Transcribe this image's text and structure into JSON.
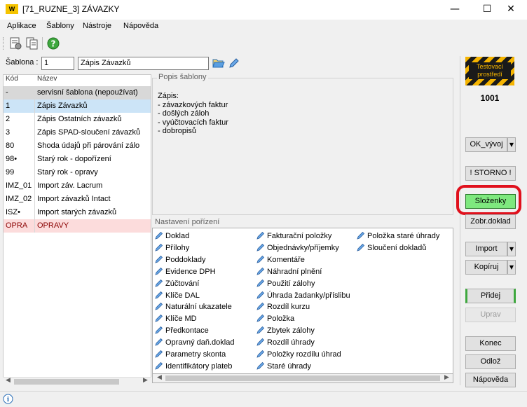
{
  "window": {
    "title": "[71_RUZNE_3] ZÁVAZKY",
    "logo_text": "W",
    "minimize": "—",
    "maximize": "☐",
    "close": "✕"
  },
  "menu": [
    "Aplikace",
    "Šablony",
    "Nástroje",
    "Nápověda"
  ],
  "template": {
    "label": "Šablona :",
    "code": "1",
    "name": "Zápis Závazků"
  },
  "grid": {
    "headers": {
      "code": "Kód",
      "name": "Název"
    },
    "rows": [
      {
        "code": "-",
        "name": "servisní šablona (nepoužívat)"
      },
      {
        "code": "1",
        "name": "Zápis Závazků"
      },
      {
        "code": "2",
        "name": "Zápis Ostatních závazků"
      },
      {
        "code": "3",
        "name": "Zápis SPAD-sloučení závazků"
      },
      {
        "code": "80",
        "name": "Shoda údajů při párování zálo"
      },
      {
        "code": "98•",
        "name": "Starý rok - dopořízení"
      },
      {
        "code": "99",
        "name": "Starý rok - opravy"
      },
      {
        "code": "IMZ_01",
        "name": "Import záv. Lacrum"
      },
      {
        "code": "IMZ_02",
        "name": "Import závazků Intact"
      },
      {
        "code": "ISZ•",
        "name": "Import starých závazků"
      },
      {
        "code": "OPRA",
        "name": "OPRAVY"
      }
    ]
  },
  "description": {
    "title": "Popis šablony",
    "lines": [
      "Zápis:",
      "- závazkových faktur",
      "- došlých záloh",
      "- vyúčtovacích faktur",
      "- dobropisů"
    ]
  },
  "settings": {
    "title": "Nastavení pořízení",
    "col1": [
      "Doklad",
      "Přílohy",
      "Poddoklady",
      "Evidence DPH",
      "Zúčtování",
      "Klíče DAL",
      "Naturální ukazatele",
      "Klíče MD",
      "Předkontace",
      "Opravný daň.doklad",
      "Parametry skonta",
      "Identifikátory plateb"
    ],
    "col2": [
      "Fakturační položky",
      "Objednávky/příjemky",
      "Komentáře",
      "Náhradní plnění",
      "Použití zálohy",
      "Úhrada žadanky/příslibu",
      "Rozdíl kurzu",
      "Položka",
      "Zbytek zálohy",
      "Rozdíl úhrady",
      "Položky rozdílu úhrad",
      "Staré úhrady"
    ],
    "col3": [
      "Položka staré úhrady",
      "Sloučení dokladů"
    ]
  },
  "right_panel": {
    "env_badge": "Testovací prostředí",
    "env_number": "1001",
    "ok_vyvoj": "OK_vývoj",
    "storno": "! STORNO !",
    "slozenky": "Složenky",
    "zobr_doklad": "Zobr.doklad",
    "import": "Import",
    "kopiruj": "Kopíruj",
    "pridej": "Přidej",
    "uprav": "Uprav",
    "konec": "Konec",
    "odloz": "Odlož",
    "napoveda": "Nápověda"
  },
  "colors": {
    "selected_row": "#cce4f7",
    "highlight_row": "#fcdcdc",
    "service_row": "#d8d8d8",
    "slozenky_bg": "#7ee87e",
    "annotation": "#e0101c"
  }
}
